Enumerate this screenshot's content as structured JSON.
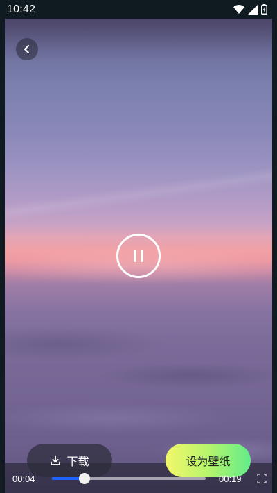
{
  "status_bar": {
    "time": "10:42",
    "icons": [
      "wifi-icon",
      "cellular-signal-icon",
      "battery-charging-icon"
    ]
  },
  "player": {
    "back_icon": "chevron-left-icon",
    "state_icon": "pause-icon",
    "current_time": "00:04",
    "total_time": "00:19",
    "progress": 0.21,
    "progress_color": "#1e63ff",
    "fullscreen_icon": "fullscreen-icon"
  },
  "actions": {
    "download_label": "下载",
    "download_icon": "download-icon",
    "set_wallpaper_label": "设为壁纸",
    "set_wallpaper_gradient": [
      "#f3f76a",
      "#63ec8a"
    ]
  }
}
